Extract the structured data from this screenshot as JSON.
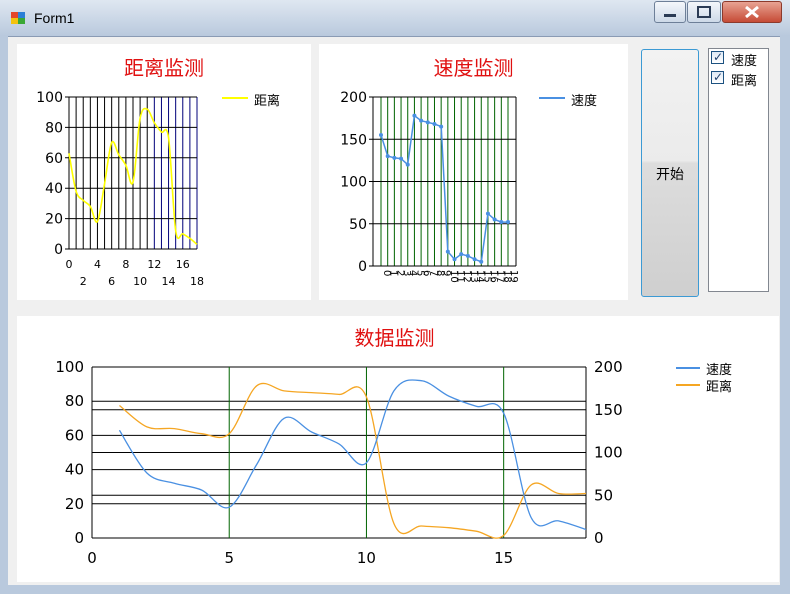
{
  "window": {
    "title": "Form1"
  },
  "colors": {
    "distance": "#ffff00",
    "speed": "#4a90e2",
    "distance_combined": "#f5a623",
    "title_red": "#e01010"
  },
  "chart1": {
    "title": "距离监测",
    "legend": "距离"
  },
  "chart2": {
    "title": "速度监测",
    "legend": "速度"
  },
  "chart3": {
    "title": "数据监测",
    "legend_speed": "速度",
    "legend_distance": "距离"
  },
  "controls": {
    "start_button": "开始",
    "checklist": [
      {
        "label": "速度",
        "checked": true
      },
      {
        "label": "距离",
        "checked": true
      }
    ]
  },
  "chart_data": [
    {
      "type": "line",
      "title": "距离监测",
      "x": [
        0,
        1,
        2,
        3,
        4,
        5,
        6,
        7,
        8,
        9,
        10,
        11,
        12,
        13,
        14,
        15,
        16,
        17,
        18
      ],
      "series": [
        {
          "name": "距离",
          "values": [
            63,
            38,
            32,
            28,
            18,
            43,
            70,
            62,
            55,
            44,
            86,
            92,
            83,
            77,
            73,
            12,
            10,
            7,
            3
          ]
        }
      ],
      "xlim": [
        0,
        18
      ],
      "ylim": [
        0,
        100
      ],
      "xticks": [
        0,
        2,
        4,
        6,
        8,
        10,
        12,
        14,
        16,
        18
      ],
      "yticks": [
        0,
        20,
        40,
        60,
        80,
        100
      ]
    },
    {
      "type": "line",
      "title": "速度监测",
      "x": [
        0,
        1,
        2,
        3,
        4,
        5,
        6,
        7,
        8,
        9,
        10,
        11,
        12,
        13,
        14,
        15,
        16,
        17,
        18,
        19
      ],
      "series": [
        {
          "name": "速度",
          "values": [
            155,
            130,
            128,
            127,
            120,
            178,
            172,
            170,
            168,
            165,
            17,
            8,
            14,
            12,
            8,
            5,
            62,
            55,
            52,
            52
          ]
        }
      ],
      "xlim": [
        0,
        19
      ],
      "ylim": [
        0,
        200
      ],
      "xticks": [
        0,
        1,
        2,
        3,
        4,
        5,
        6,
        7,
        8,
        9,
        10,
        11,
        12,
        13,
        14,
        15,
        16,
        17,
        18,
        19
      ],
      "yticks": [
        0,
        50,
        100,
        150,
        200
      ]
    },
    {
      "type": "line",
      "title": "数据监测",
      "x": [
        1,
        2,
        3,
        4,
        5,
        6,
        7,
        8,
        9,
        10,
        11,
        12,
        13,
        14,
        15,
        16,
        17,
        18
      ],
      "series": [
        {
          "name": "速度",
          "axis": "left",
          "values": [
            63,
            38,
            32,
            28,
            18,
            43,
            70,
            62,
            55,
            44,
            86,
            92,
            83,
            77,
            73,
            12,
            10,
            5
          ]
        },
        {
          "name": "距离",
          "axis": "right",
          "values": [
            155,
            130,
            128,
            122,
            122,
            178,
            172,
            170,
            168,
            165,
            17,
            14,
            12,
            8,
            3,
            62,
            52,
            52
          ]
        }
      ],
      "xlim": [
        0,
        18
      ],
      "ylim_left": [
        0,
        100
      ],
      "ylim_right": [
        0,
        200
      ],
      "xticks": [
        0,
        5,
        10,
        15
      ],
      "yticks_left": [
        0,
        20,
        40,
        60,
        80,
        100
      ],
      "yticks_right": [
        0,
        50,
        100,
        150,
        200
      ]
    }
  ]
}
